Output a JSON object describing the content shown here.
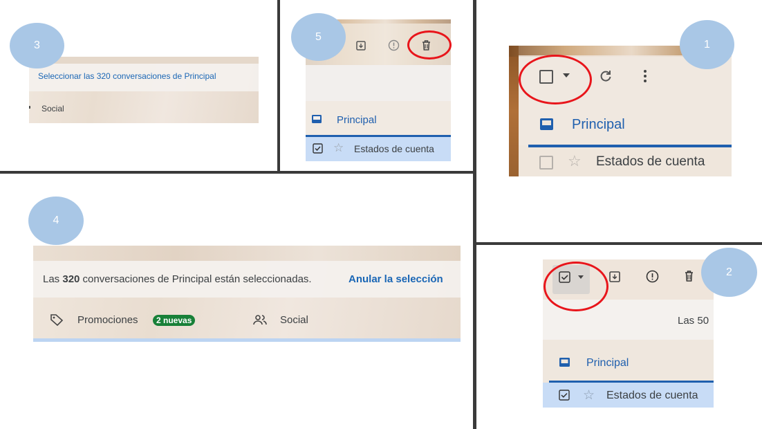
{
  "steps": [
    "1",
    "2",
    "3",
    "4",
    "5"
  ],
  "panel1": {
    "tab_label": "Principal",
    "row_label": "Estados de cuenta"
  },
  "panel2": {
    "count_partial": "Las 50",
    "tab_label": "Principal",
    "row_label": "Estados de cuenta"
  },
  "panel3": {
    "select_all_link": "Seleccionar las 320 conversaciones de Principal",
    "social_label": "Social"
  },
  "panel4": {
    "selected_prefix": "Las ",
    "selected_count": "320",
    "selected_suffix": " conversaciones de Principal están seleccionadas.",
    "undo_link": "Anular la selección",
    "promotions_label": "Promociones",
    "promotions_badge": "2 nuevas",
    "social_label": "Social"
  },
  "panel5": {
    "tab_label": "Principal",
    "row_label": "Estados de cuenta"
  },
  "colors": {
    "link_blue": "#1a66b5",
    "selected_row": "#c8dcf6",
    "badge_green": "#188038",
    "annotation_red": "#e8151b",
    "step_circle": "#a9c7e6"
  },
  "icons": [
    "checkbox-icon",
    "dropdown-caret-icon",
    "refresh-icon",
    "more-vert-icon",
    "inbox-icon",
    "star-icon",
    "archive-icon",
    "report-spam-icon",
    "delete-icon",
    "label-tag-icon",
    "people-icon"
  ]
}
